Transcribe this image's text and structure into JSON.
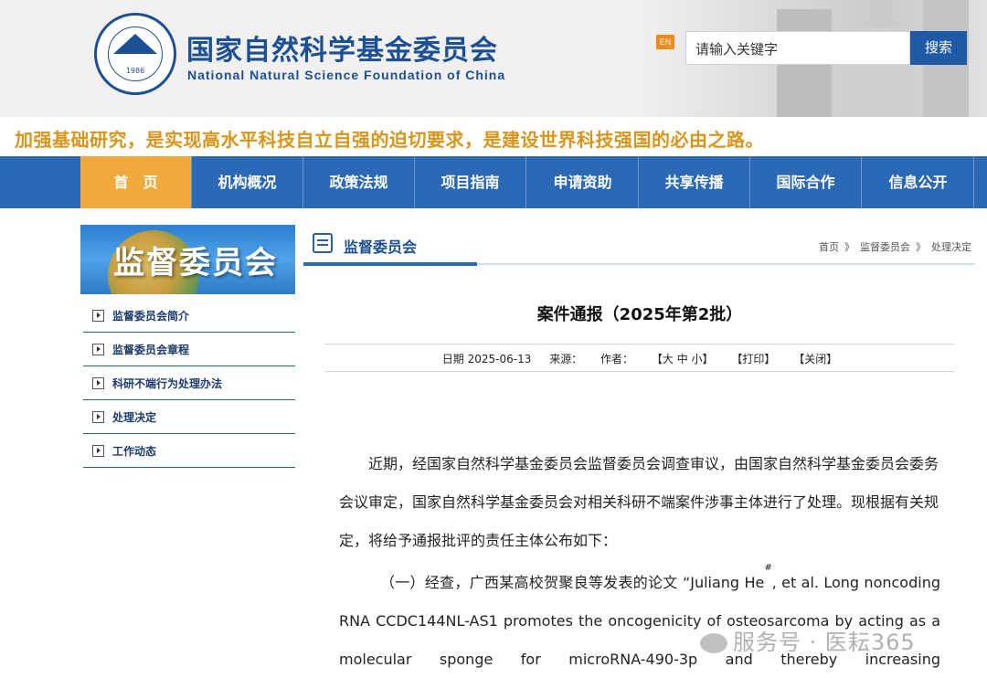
{
  "header": {
    "org_cn": "国家自然科学基金委员会",
    "org_en": "National Natural Science Foundation of China",
    "logo_year": "1986",
    "lang_button": "EN",
    "search_placeholder": "请输入关键字",
    "search_button": "搜索"
  },
  "slogan": "加强基础研究，是实现高水平科技自立自强的迫切要求，是建设世界科技强国的必由之路。",
  "nav": {
    "items": [
      "首　页",
      "机构概况",
      "政策法规",
      "项目指南",
      "申请资助",
      "共享传播",
      "国际合作",
      "信息公开"
    ],
    "active_index": 0
  },
  "sidebar": {
    "banner_title": "监督委员会",
    "items": [
      {
        "label": "监督委员会简介"
      },
      {
        "label": "监督委员会章程"
      },
      {
        "label": "科研不端行为处理办法"
      },
      {
        "label": "处理决定"
      },
      {
        "label": "工作动态"
      }
    ]
  },
  "section": {
    "title": "监督委员会",
    "breadcrumb": [
      "首页",
      "监督委员会",
      "处理决定"
    ],
    "breadcrumb_sep": "》"
  },
  "article": {
    "title": "案件通报（2025年第2批）",
    "date_label": "日期",
    "date": "2025-06-13",
    "source_label": "来源：",
    "author_label": "作者：",
    "font_size_ctrl": "【大 中 小】",
    "print": "【打印】",
    "close": "【关闭】",
    "para1": "近期，经国家自然科学基金委员会监督委员会调查审议，由国家自然科学基金委员会委务会议审定，国家自然科学基金委员会对相关科研不端案件涉事主体进行了处理。现根据有关规定，将给予通报批评的责任主体公布如下：",
    "para2_a": "（一）经查，广西某高校贺聚良等发表的论文 “Juliang He",
    "para2_sup": "#",
    "para2_b": ", et al. Long noncoding RNA CCDC144NL-AS1 promotes the oncogenicity of osteosarcoma by acting as a molecular sponge for microRNA-490-3p and thereby increasing"
  },
  "watermark": "服务号 · 医耘365",
  "colors": {
    "primary_blue": "#1d4f94",
    "nav_blue": "#2b68b5",
    "nav_active": "#f2a93b",
    "slogan": "#d9941a",
    "search_button": "#1f5aa5"
  }
}
